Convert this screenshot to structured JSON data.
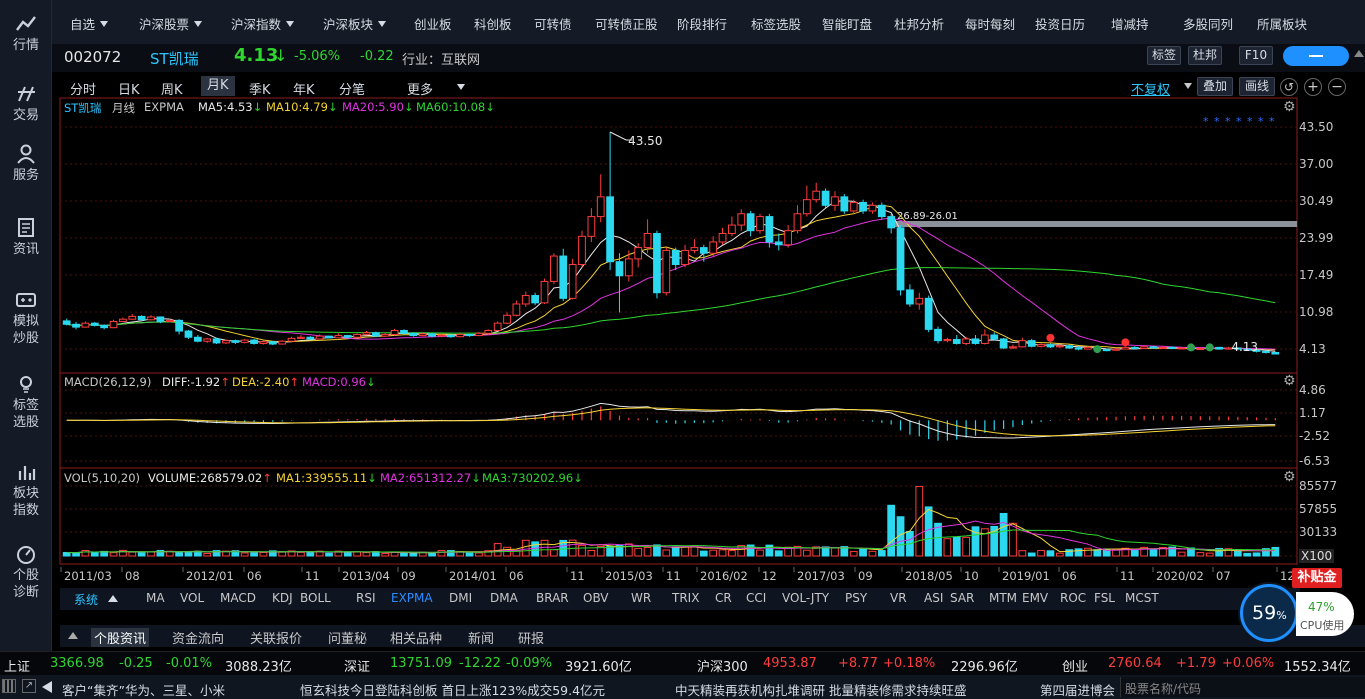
{
  "sidebar": [
    {
      "label": "行情",
      "icon": "quote-icon"
    },
    {
      "label": "交易",
      "icon": "trade-icon"
    },
    {
      "label": "服务",
      "icon": "user-icon"
    },
    {
      "label": "资讯",
      "icon": "news-icon"
    },
    {
      "label": "模拟炒股",
      "l1": "模拟",
      "l2": "炒股",
      "icon": "simulate-icon"
    },
    {
      "label": "标签选股",
      "l1": "标签",
      "l2": "选股",
      "icon": "bulb-icon"
    },
    {
      "label": "板块指数",
      "l1": "板块",
      "l2": "指数",
      "icon": "bars-icon"
    },
    {
      "label": "个股诊断",
      "l1": "个股",
      "l2": "诊断",
      "icon": "gauge-icon"
    }
  ],
  "nav": [
    "自选",
    "沪深股票",
    "沪深指数",
    "沪深板块",
    "创业板",
    "科创板",
    "可转债",
    "可转债正股",
    "阶段排行",
    "标签选股",
    "智能盯盘",
    "杜邦分析",
    "每时每刻",
    "投资日历",
    "增减持",
    "多股同列",
    "所属板块"
  ],
  "stock": {
    "code": "002072",
    "name": "ST凯瑞",
    "price": "4.13",
    "pct": "-5.06%",
    "chg": "-0.22",
    "industry": "行业：互联网"
  },
  "stock_buttons": [
    "标签",
    "杜邦",
    "F10"
  ],
  "periods": [
    "分时",
    "日K",
    "周K",
    "月K",
    "季K",
    "年K",
    "分笔",
    "更多"
  ],
  "active_period": "月K",
  "right_controls": {
    "adjust": "不复权",
    "overlay": "叠加",
    "draw": "画线"
  },
  "legends": {
    "main": [
      "ST凯瑞",
      "月线",
      "EXPMA"
    ],
    "ma5": "MA5:4.53",
    "ma10": "MA10:4.79",
    "ma20": "MA20:5.90",
    "ma60": "MA60:10.08",
    "macd_title": "MACD(26,12,9)",
    "diff": "DIFF:-1.92",
    "dea": "DEA:-2.40",
    "macd": "MACD:0.96",
    "vol_title": "VOL(5,10,20)",
    "volume": "VOLUME:268579.02",
    "ma1": "MA1:339555.11",
    "ma2": "MA2:651312.27",
    "ma3": "MA3:730202.96"
  },
  "price_axis": [
    "43.50",
    "37.00",
    "30.49",
    "23.99",
    "17.49",
    "10.98",
    "4.13"
  ],
  "macd_axis": [
    "4.86",
    "1.17",
    "-2.52",
    "-6.53"
  ],
  "vol_axis": [
    "85577",
    "57855",
    "30133",
    "X100"
  ],
  "annotations": {
    "high": "43.50",
    "level": "26.89-26.01",
    "last": "4.13",
    "stars": "* * * * * * *"
  },
  "time_axis": [
    "2011/03",
    "08",
    "2012/01",
    "06",
    "11",
    "2013/04",
    "09",
    "2014/01",
    "06",
    "11",
    "2015/03",
    "11",
    "2016/02",
    "12",
    "2017/03",
    "09",
    "2018/05",
    "10",
    "2019/01",
    "06",
    "11",
    "2020/02",
    "07",
    "12"
  ],
  "indicators": [
    "系统",
    "MA",
    "VOL",
    "MACD",
    "KDJ",
    "BOLL",
    "RSI",
    "EXPMA",
    "DMI",
    "DMA",
    "BRAR",
    "OBV",
    "WR",
    "TRIX",
    "CR",
    "CCI",
    "VOL-JTY",
    "PSY",
    "VR",
    "ASI",
    "SAR",
    "MTM",
    "EMV",
    "ROC",
    "FSL",
    "MCST"
  ],
  "active_indicator": "EXPMA",
  "info_tabs": [
    "个股资讯",
    "资金流向",
    "关联报价",
    "问董秘",
    "相关品种",
    "新闻",
    "研报"
  ],
  "cpu": {
    "value": "59",
    "unit": "%",
    "pct": "47%",
    "label": "CPU使用"
  },
  "badge": "补贴金",
  "ticker": [
    {
      "name": "上证",
      "price": "3366.98",
      "chg": "-0.25",
      "pct": "-0.01%",
      "amt": "3088.23亿",
      "dir": "down"
    },
    {
      "name": "深证",
      "price": "13751.09",
      "chg": "-12.22",
      "pct": "-0.09%",
      "amt": "3921.60亿",
      "dir": "down"
    },
    {
      "name": "沪深300",
      "price": "4953.87",
      "chg": "+8.77",
      "pct": "+0.18%",
      "amt": "2296.96亿",
      "dir": "up"
    },
    {
      "name": "创业",
      "price": "2760.64",
      "chg": "+1.79",
      "pct": "+0.06%",
      "amt": "1552.34亿",
      "dir": "up"
    }
  ],
  "news": [
    "客户“集齐”华为、三星、小米",
    "恒玄科技今日登陆科创板 首日上涨123%成交59.4亿元",
    "中天精装再获机构扎堆调研 批量精装修需求持续旺盛",
    "第四届进博会"
  ],
  "search_placeholder": "股票名称/代码",
  "chart_data": {
    "type": "candlestick",
    "price_ylim": [
      4.13,
      43.5
    ],
    "candles": [
      [
        10,
        9.4,
        10.4,
        9.2
      ],
      [
        9.4,
        8.9,
        9.8,
        8.5
      ],
      [
        8.9,
        9.6,
        9.9,
        8.8
      ],
      [
        9.6,
        9.2,
        9.8,
        9.0
      ],
      [
        9.2,
        8.8,
        9.4,
        8.5
      ],
      [
        8.8,
        9.9,
        10.2,
        8.7
      ],
      [
        9.9,
        10.3,
        10.6,
        9.8
      ],
      [
        10.3,
        10.8,
        11.2,
        10.2
      ],
      [
        10.8,
        10.2,
        11.0,
        9.9
      ],
      [
        10.2,
        10.7,
        11.0,
        10.1
      ],
      [
        10.7,
        9.9,
        10.8,
        9.6
      ],
      [
        9.9,
        10.1,
        10.4,
        9.7
      ],
      [
        10.1,
        8.2,
        10.3,
        7.6
      ],
      [
        8.2,
        7.1,
        8.4,
        6.8
      ],
      [
        7.1,
        6.4,
        7.5,
        6.2
      ],
      [
        6.4,
        6.8,
        7.0,
        6.1
      ],
      [
        6.8,
        6.1,
        7.0,
        5.9
      ],
      [
        6.1,
        6.5,
        6.7,
        5.9
      ],
      [
        6.5,
        6.2,
        6.7,
        5.9
      ],
      [
        6.2,
        6.6,
        6.8,
        6.0
      ],
      [
        6.6,
        6.0,
        6.8,
        5.8
      ],
      [
        6.0,
        6.3,
        6.6,
        5.8
      ],
      [
        6.3,
        5.9,
        6.4,
        5.7
      ],
      [
        5.9,
        6.4,
        6.6,
        5.8
      ],
      [
        6.4,
        6.9,
        7.2,
        6.3
      ],
      [
        6.9,
        7.1,
        7.5,
        6.8
      ],
      [
        7.1,
        6.8,
        7.3,
        6.6
      ],
      [
        6.8,
        7.3,
        7.6,
        6.7
      ],
      [
        7.3,
        7.0,
        7.4,
        6.9
      ],
      [
        7.0,
        7.4,
        7.8,
        6.9
      ],
      [
        7.4,
        7.1,
        7.5,
        6.9
      ],
      [
        7.1,
        7.6,
        7.8,
        7.0
      ],
      [
        7.6,
        7.9,
        8.2,
        7.4
      ],
      [
        7.9,
        7.3,
        8.1,
        7.1
      ],
      [
        7.3,
        7.6,
        7.9,
        7.2
      ],
      [
        7.6,
        8.3,
        8.6,
        7.4
      ],
      [
        8.3,
        7.8,
        8.5,
        7.6
      ],
      [
        7.8,
        7.4,
        8.0,
        7.2
      ],
      [
        7.4,
        7.7,
        7.9,
        7.3
      ],
      [
        7.7,
        7.3,
        7.8,
        7.1
      ],
      [
        7.3,
        7.5,
        7.7,
        7.1
      ],
      [
        7.5,
        7.2,
        7.6,
        7.0
      ],
      [
        7.2,
        7.6,
        7.8,
        7.1
      ],
      [
        7.6,
        7.4,
        7.7,
        7.2
      ],
      [
        7.4,
        7.8,
        8.0,
        7.3
      ],
      [
        7.8,
        8.3,
        8.5,
        7.6
      ],
      [
        8.3,
        9.6,
        9.9,
        8.2
      ],
      [
        9.6,
        11.0,
        11.5,
        9.4
      ],
      [
        11.0,
        13.0,
        13.6,
        10.8
      ],
      [
        13.0,
        14.5,
        15.2,
        12.5
      ],
      [
        14.5,
        13.2,
        15.0,
        12.8
      ],
      [
        13.2,
        17.0,
        17.5,
        13.0
      ],
      [
        17.0,
        21.5,
        22.0,
        16.5
      ],
      [
        21.5,
        14.0,
        22.8,
        13.5
      ],
      [
        14.0,
        20.0,
        21.0,
        13.8
      ],
      [
        20.0,
        25.0,
        26.0,
        19.5
      ],
      [
        25.0,
        28.5,
        30.0,
        24.0
      ],
      [
        28.5,
        32.0,
        36.0,
        27.5
      ],
      [
        32.0,
        20.5,
        43.5,
        19.0
      ],
      [
        20.5,
        18.0,
        22.0,
        11.5
      ],
      [
        18.0,
        21.0,
        22.5,
        17.0
      ],
      [
        21.0,
        23.0,
        23.8,
        19.5
      ],
      [
        23.0,
        25.5,
        28.0,
        22.0
      ],
      [
        25.5,
        15.0,
        26.0,
        14.0
      ],
      [
        15.0,
        22.5,
        23.0,
        14.5
      ],
      [
        22.5,
        20.0,
        23.0,
        19.0
      ],
      [
        20.0,
        22.5,
        23.5,
        19.5
      ],
      [
        22.5,
        23.0,
        24.5,
        22.0
      ],
      [
        23.0,
        22.0,
        23.5,
        20.5
      ],
      [
        22.0,
        24.0,
        25.0,
        21.5
      ],
      [
        24.0,
        25.5,
        26.5,
        23.5
      ],
      [
        25.5,
        27.0,
        28.5,
        25.0
      ],
      [
        27.0,
        29.0,
        29.8,
        26.0
      ],
      [
        29.0,
        26.0,
        29.5,
        25.0
      ],
      [
        26.0,
        28.5,
        29.0,
        25.5
      ],
      [
        28.5,
        24.0,
        29.0,
        23.0
      ],
      [
        24.0,
        23.5,
        25.5,
        22.5
      ],
      [
        23.5,
        26.0,
        27.0,
        23.0
      ],
      [
        26.0,
        29.0,
        30.5,
        25.5
      ],
      [
        29.0,
        31.5,
        34.0,
        28.5
      ],
      [
        31.5,
        33.0,
        34.5,
        31.0
      ],
      [
        33.0,
        30.5,
        33.5,
        30.0
      ],
      [
        30.5,
        32.0,
        33.0,
        29.5
      ],
      [
        32.0,
        29.5,
        32.5,
        29.0
      ],
      [
        29.5,
        31.0,
        31.5,
        29.0
      ],
      [
        31.0,
        29.5,
        31.5,
        29.0
      ],
      [
        29.5,
        30.5,
        31.0,
        29.0
      ],
      [
        30.5,
        28.5,
        31.0,
        28.0
      ],
      [
        28.5,
        26.5,
        29.0,
        25.5
      ],
      [
        26.5,
        15.5,
        27.0,
        14.5
      ],
      [
        15.5,
        13.0,
        16.5,
        12.5
      ],
      [
        13.0,
        14.0,
        15.0,
        12.0
      ],
      [
        14.0,
        8.5,
        14.5,
        8.0
      ],
      [
        8.5,
        6.5,
        9.0,
        6.0
      ],
      [
        6.5,
        6.7,
        7.0,
        6.2
      ],
      [
        6.7,
        6.0,
        7.5,
        5.8
      ],
      [
        6.0,
        6.8,
        7.2,
        5.7
      ],
      [
        6.8,
        6.0,
        7.5,
        5.8
      ],
      [
        6.0,
        7.5,
        8.5,
        5.8
      ],
      [
        7.5,
        6.8,
        8.0,
        6.5
      ],
      [
        6.8,
        5.2,
        7.0,
        5.0
      ],
      [
        5.2,
        5.4,
        5.8,
        5.0
      ],
      [
        5.4,
        6.5,
        7.0,
        5.3
      ],
      [
        6.5,
        5.5,
        6.8,
        5.3
      ],
      [
        5.5,
        5.8,
        6.0,
        5.3
      ],
      [
        5.8,
        5.4,
        6.0,
        5.2
      ],
      [
        5.4,
        5.6,
        5.8,
        5.2
      ],
      [
        5.6,
        5.2,
        5.8,
        5.0
      ],
      [
        5.2,
        5.0,
        5.5,
        4.8
      ],
      [
        5.0,
        5.3,
        5.5,
        4.9
      ],
      [
        5.3,
        4.9,
        5.4,
        4.7
      ],
      [
        4.9,
        4.8,
        5.1,
        4.6
      ],
      [
        4.8,
        5.0,
        5.2,
        4.7
      ],
      [
        5.0,
        5.3,
        5.5,
        4.9
      ],
      [
        5.3,
        5.1,
        5.5,
        5.0
      ],
      [
        5.1,
        5.4,
        5.6,
        5.0
      ],
      [
        5.4,
        5.2,
        5.6,
        5.0
      ],
      [
        5.2,
        5.3,
        5.5,
        5.0
      ],
      [
        5.3,
        5.1,
        5.5,
        5.0
      ],
      [
        5.1,
        5.2,
        5.4,
        5.0
      ],
      [
        5.2,
        5.0,
        5.3,
        4.9
      ],
      [
        5.0,
        5.1,
        5.3,
        4.9
      ],
      [
        5.1,
        5.3,
        5.5,
        5.0
      ],
      [
        5.3,
        5.0,
        5.4,
        4.9
      ],
      [
        5.0,
        5.2,
        5.4,
        4.9
      ],
      [
        5.2,
        5.0,
        5.3,
        4.8
      ],
      [
        5.0,
        4.8,
        5.1,
        4.7
      ],
      [
        4.8,
        4.6,
        4.9,
        4.4
      ],
      [
        4.6,
        4.4,
        4.7,
        4.2
      ],
      [
        4.4,
        4.13,
        4.5,
        4.1
      ]
    ],
    "volume_ylim": [
      0,
      85577
    ],
    "macd_ylim": [
      -6.53,
      4.86
    ]
  }
}
